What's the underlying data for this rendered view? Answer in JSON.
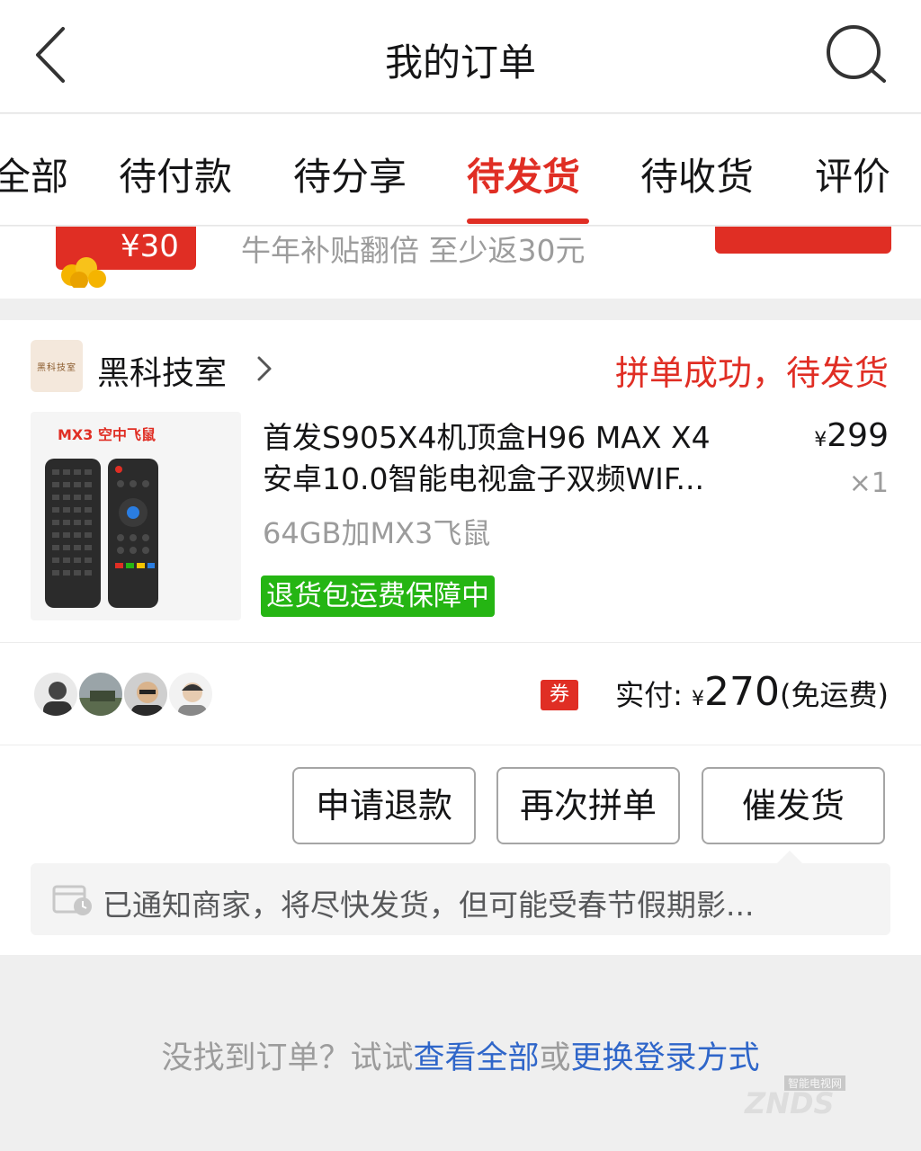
{
  "header": {
    "title": "我的订单",
    "back_icon": "chevron-left-icon",
    "search_icon": "search-icon"
  },
  "tabs": [
    {
      "label": "全部",
      "active": false
    },
    {
      "label": "待付款",
      "active": false
    },
    {
      "label": "待分享",
      "active": false
    },
    {
      "label": "待发货",
      "active": true
    },
    {
      "label": "待收货",
      "active": false
    },
    {
      "label": "评价",
      "active": false
    }
  ],
  "banner": {
    "redpack_amount": "¥30",
    "text": "牛年补贴翻倍 至少返30元"
  },
  "order": {
    "store_logo_text": "黑科技室",
    "store_name": "黑科技室",
    "status": "拼单成功，待发货",
    "thumb_label": "MX3 空中飞鼠",
    "product_title_line1": "首发S905X4机顶盒H96 MAX X4",
    "product_title_line2": "安卓10.0智能电视盒子双频WIF...",
    "price_symbol": "¥",
    "price": "299",
    "quantity": "×1",
    "spec": "64GB加MX3飞鼠",
    "badge": "退货包运费保障中",
    "coupon_label": "券",
    "paid_label": "实付:",
    "paid_symbol": "¥",
    "paid_amount": "270",
    "shipping_note": "(免运费)"
  },
  "actions": {
    "refund": "申请退款",
    "regroup": "再次拼单",
    "urge": "催发货"
  },
  "notice": {
    "text": "已通知商家，将尽快发货，但可能受春节假期影..."
  },
  "footer": {
    "prefix": "没找到订单？试试",
    "link1": "查看全部",
    "middle": "或",
    "link2": "更换登录方式"
  },
  "watermark": {
    "top": "智能电视网",
    "main": "ZNDS"
  },
  "colors": {
    "accent": "#e02e24",
    "badge_green": "#25b513",
    "link_blue": "#2f66c9"
  }
}
